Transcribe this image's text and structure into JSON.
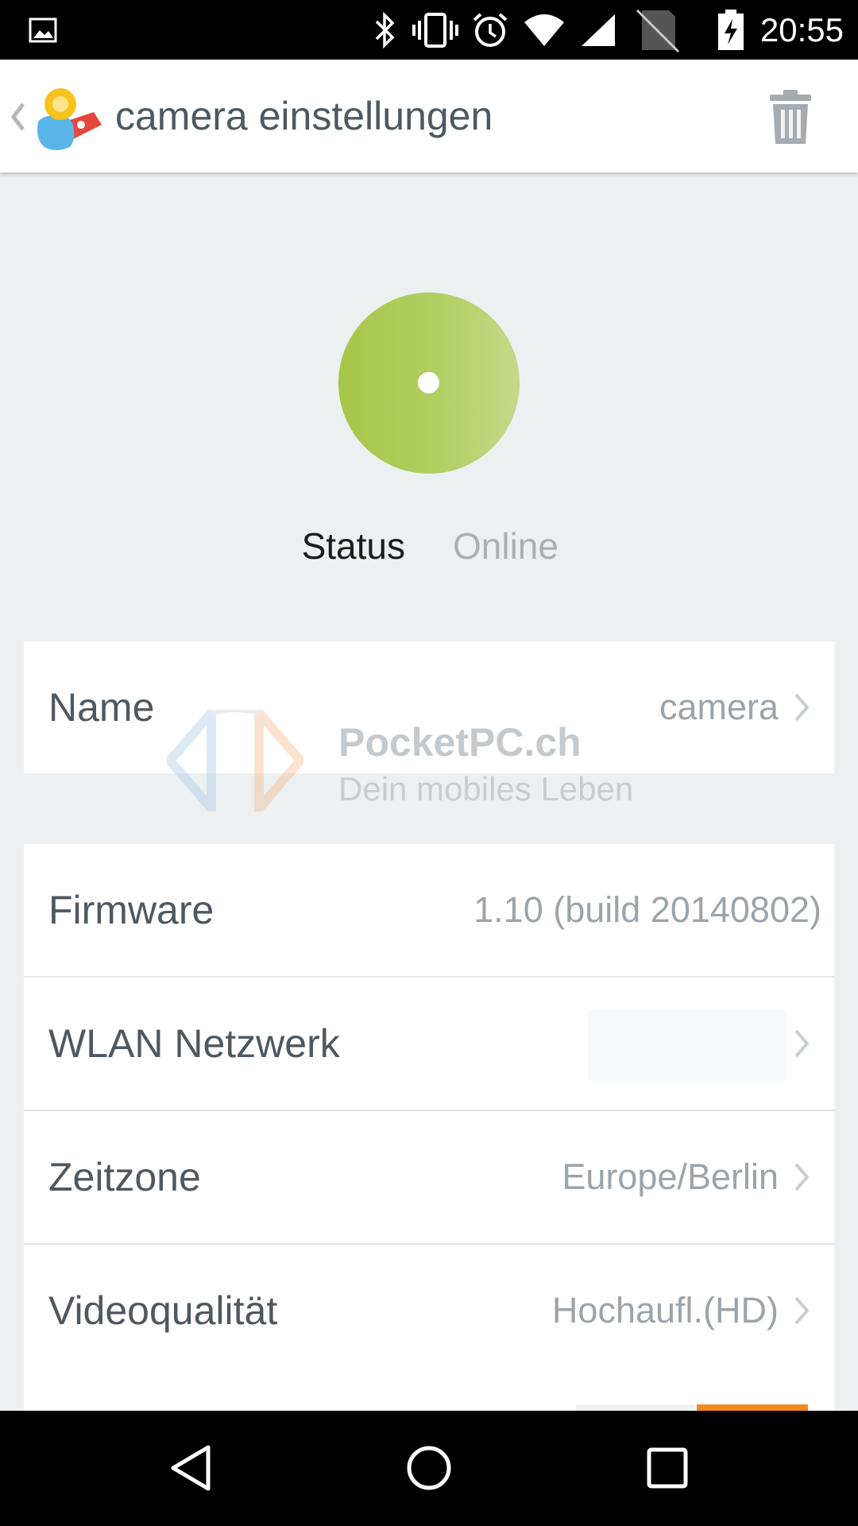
{
  "status_bar": {
    "time": "20:55",
    "icons": [
      "gallery-icon",
      "bluetooth-icon",
      "vibrate-icon",
      "alarm-icon",
      "wifi-icon",
      "signal-icon",
      "no-sim-icon",
      "battery-charging-icon"
    ]
  },
  "app_bar": {
    "title": "camera einstellungen",
    "back_icon": "chevron-left-icon",
    "logo_icon": "app-logo-icon",
    "action_icon": "trash-icon"
  },
  "status": {
    "label": "Status",
    "value": "Online",
    "indicator_color": "#a6c748"
  },
  "settings": {
    "name": {
      "label": "Name",
      "value": "camera"
    },
    "rows": [
      {
        "label": "Firmware",
        "value": "1.10 (build 20140802)"
      },
      {
        "label": "WLAN Netzwerk",
        "value": ""
      },
      {
        "label": "Zeitzone",
        "value": "Europe/Berlin"
      },
      {
        "label": "Videoqualität",
        "value": "Hochaufl.(HD)"
      }
    ]
  },
  "watermark": {
    "title": "PocketPC.ch",
    "subtitle": "Dein mobiles Leben"
  },
  "nav_bar": {
    "icons": [
      "back-triangle-icon",
      "home-circle-icon",
      "recents-square-icon"
    ]
  },
  "colors": {
    "accent_green": "#a6c748",
    "accent_orange": "#f28a1b",
    "text_primary": "#4f5860",
    "text_secondary": "#9ca4ab"
  }
}
